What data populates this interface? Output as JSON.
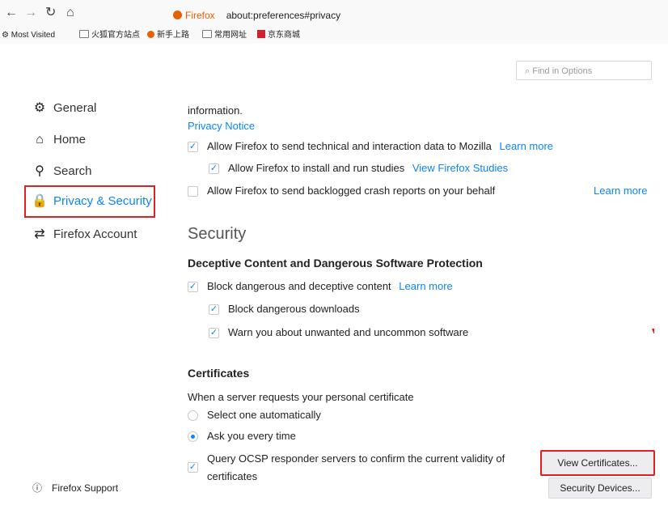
{
  "toolbar": {
    "back_icon": "back-arrow-icon",
    "forward_icon": "forward-arrow-icon",
    "reload_icon": "reload-icon",
    "home_icon": "home-icon"
  },
  "urlbar": {
    "brand": "Firefox",
    "url": "about:preferences#privacy"
  },
  "bookmarks": [
    {
      "label": "Most Visited",
      "icon": "gear-icon"
    },
    {
      "label": "火狐官方站点",
      "icon": "folder-icon"
    },
    {
      "label": "新手上路",
      "icon": "firefox-icon"
    },
    {
      "label": "常用网址",
      "icon": "folder-icon"
    },
    {
      "label": "京东商城",
      "icon": "jd-icon"
    }
  ],
  "search": {
    "placeholder": "Find in Options"
  },
  "sidebar": {
    "items": [
      {
        "label": "General",
        "icon": "gear-icon"
      },
      {
        "label": "Home",
        "icon": "home-icon"
      },
      {
        "label": "Search",
        "icon": "search-icon"
      },
      {
        "label": "Privacy & Security",
        "icon": "lock-icon",
        "selected": true
      },
      {
        "label": "Firefox Account",
        "icon": "sync-icon"
      }
    ],
    "support": "Firefox Support"
  },
  "content": {
    "info_text": "information.",
    "privacy_notice": "Privacy Notice",
    "data_collection": [
      {
        "label": "Allow Firefox to send technical and interaction data to Mozilla",
        "checked": true,
        "link": "Learn more"
      },
      {
        "label": "Allow Firefox to install and run studies",
        "checked": true,
        "link": "View Firefox Studies"
      },
      {
        "label": "Allow Firefox to send backlogged crash reports on your behalf",
        "checked": false,
        "link": "Learn more"
      }
    ],
    "security_title": "Security",
    "deceptive_title": "Deceptive Content and Dangerous Software Protection",
    "deceptive": [
      {
        "label": "Block dangerous and deceptive content",
        "checked": true,
        "link": "Learn more"
      },
      {
        "label": "Block dangerous downloads",
        "checked": true
      },
      {
        "label": "Warn you about unwanted and uncommon software",
        "checked": true
      }
    ],
    "certs_title": "Certificates",
    "certs_desc": "When a server requests your personal certificate",
    "radio_options": [
      {
        "label": "Select one automatically",
        "selected": false
      },
      {
        "label": "Ask you every time",
        "selected": true
      }
    ],
    "ocsp_line1": "Query OCSP responder servers to confirm the current validity of",
    "ocsp_line2": "certificates",
    "ocsp_checked": true,
    "view_certs_button": "View Certificates...",
    "security_devices_button": "Security Devices..."
  },
  "colors": {
    "accent": "#0a84ff",
    "highlight": "#e02020"
  }
}
